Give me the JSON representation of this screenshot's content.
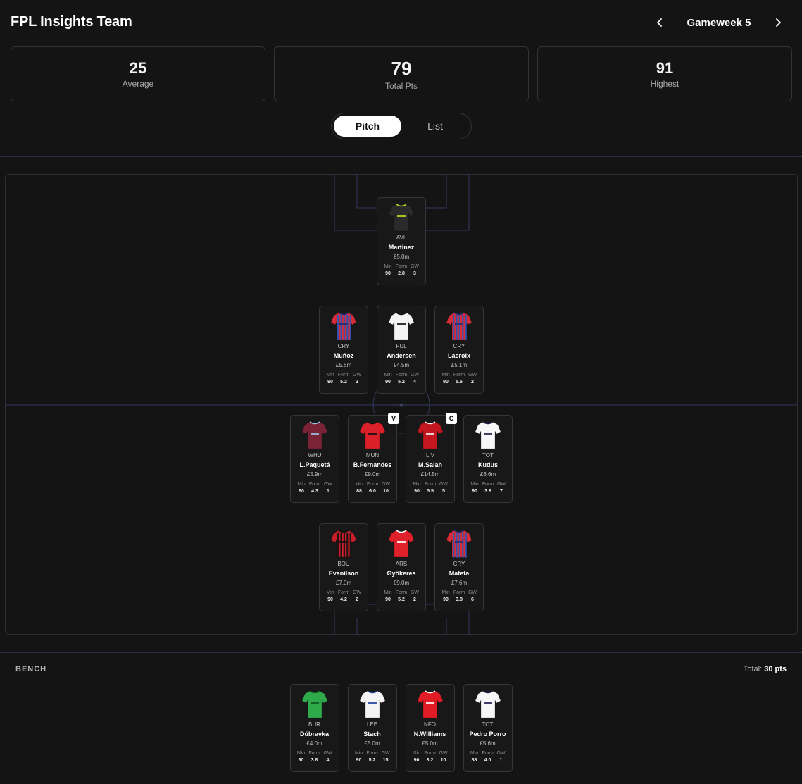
{
  "header": {
    "title": "FPL Insights Team",
    "gameweek_label": "Gameweek 5"
  },
  "stats": [
    {
      "value": "25",
      "label": "Average"
    },
    {
      "value": "79",
      "label": "Total Pts"
    },
    {
      "value": "91",
      "label": "Highest"
    }
  ],
  "view_toggle": {
    "pitch": "Pitch",
    "list": "List",
    "active": "Pitch"
  },
  "stat_heads": {
    "min": "Min",
    "form": "Form",
    "gw": "GW"
  },
  "pitch": {
    "goalkeeper": [
      {
        "team": "AVL",
        "name": "Martinez",
        "price": "£5.0m",
        "min": "90",
        "form": "2.8",
        "gw": "3",
        "shirt": "#2a2a2a",
        "stripe": "none",
        "accent": "#b9e11e"
      }
    ],
    "defenders": [
      {
        "team": "CRY",
        "name": "Muñoz",
        "price": "£5.6m",
        "min": "90",
        "form": "5.2",
        "gw": "2",
        "shirt": "#d62c3a",
        "stripe": "#2a56b8",
        "accent": "#1b2f7a"
      },
      {
        "team": "FUL",
        "name": "Andersen",
        "price": "£4.5m",
        "min": "90",
        "form": "5.2",
        "gw": "4",
        "shirt": "#f4f4f4",
        "stripe": "none",
        "accent": "#111111"
      },
      {
        "team": "CRY",
        "name": "Lacroix",
        "price": "£5.1m",
        "min": "90",
        "form": "5.5",
        "gw": "2",
        "shirt": "#d62c3a",
        "stripe": "#2a56b8",
        "accent": "#1b2f7a"
      }
    ],
    "midfielders": [
      {
        "team": "WHU",
        "name": "L.Paquetá",
        "price": "£5.9m",
        "min": "90",
        "form": "4.3",
        "gw": "1",
        "shirt": "#7a2236",
        "stripe": "none",
        "accent": "#9cc4e4"
      },
      {
        "team": "MUN",
        "name": "B.Fernandes",
        "price": "£9.0m",
        "min": "88",
        "form": "6.0",
        "gw": "10",
        "shirt": "#da2028",
        "stripe": "none",
        "accent": "#111111",
        "badge": "V"
      },
      {
        "team": "LIV",
        "name": "M.Salah",
        "price": "£14.5m",
        "min": "90",
        "form": "5.5",
        "gw": "5",
        "shirt": "#c3161f",
        "stripe": "none",
        "accent": "#f2f2f2",
        "badge": "C"
      },
      {
        "team": "TOT",
        "name": "Kudus",
        "price": "£6.6m",
        "min": "90",
        "form": "3.8",
        "gw": "7",
        "shirt": "#f7f7f7",
        "stripe": "none",
        "accent": "#1b2050"
      }
    ],
    "forwards": [
      {
        "team": "BOU",
        "name": "Evanilson",
        "price": "£7.0m",
        "min": "90",
        "form": "4.2",
        "gw": "2",
        "shirt": "#c8202a",
        "stripe": "#111111",
        "accent": "#111111"
      },
      {
        "team": "ARS",
        "name": "Gyökeres",
        "price": "£9.0m",
        "min": "90",
        "form": "5.2",
        "gw": "2",
        "shirt": "#e0202a",
        "stripe": "none",
        "accent": "#ffffff"
      },
      {
        "team": "CRY",
        "name": "Mateta",
        "price": "£7.6m",
        "min": "90",
        "form": "3.8",
        "gw": "6",
        "shirt": "#d62c3a",
        "stripe": "#2a56b8",
        "accent": "#1b2f7a"
      }
    ]
  },
  "bench": {
    "title": "BENCH",
    "total_prefix": "Total:",
    "total_value": "30 pts",
    "players": [
      {
        "team": "BUR",
        "name": "Dúbravka",
        "price": "£4.0m",
        "min": "90",
        "form": "3.8",
        "gw": "4",
        "shirt": "#2faa4a",
        "stripe": "none",
        "accent": "#0f5a22"
      },
      {
        "team": "LEE",
        "name": "Stach",
        "price": "£5.0m",
        "min": "90",
        "form": "5.2",
        "gw": "15",
        "shirt": "#f4f4f4",
        "stripe": "none",
        "accent": "#1d3f9b"
      },
      {
        "team": "NFO",
        "name": "N.Williams",
        "price": "£5.0m",
        "min": "90",
        "form": "3.2",
        "gw": "10",
        "shirt": "#e21c24",
        "stripe": "none",
        "accent": "#ffffff"
      },
      {
        "team": "TOT",
        "name": "Pedro Porro",
        "price": "£5.6m",
        "min": "88",
        "form": "4.0",
        "gw": "1",
        "shirt": "#f7f7f7",
        "stripe": "none",
        "accent": "#1b2050"
      }
    ]
  }
}
